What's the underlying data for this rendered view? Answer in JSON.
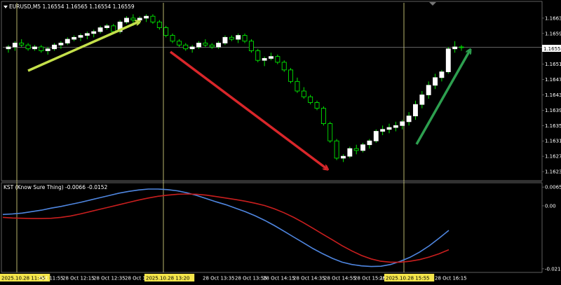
{
  "header": {
    "symbol_line": "EURUSD,M5  1.16554 1.16565 1.16554 1.16559",
    "indicator_line": "KST (Know Sure Thing) -0.0066 -0.0152"
  },
  "price_axis": {
    "labels": [
      "1.16635",
      "1.16595",
      "1.16559",
      "1.16515",
      "1.16475",
      "1.16435",
      "1.16395",
      "1.16355",
      "1.16315",
      "1.16275",
      "1.16235"
    ],
    "current_price": "1.16559"
  },
  "kst_axis": {
    "labels": [
      "0.0065",
      "0.00",
      "-0.0218"
    ]
  },
  "time_axis": {
    "labels": [
      "2025.10.28 11:45",
      "Oct 11:55",
      "28 Oct 12:15",
      "28 Oct 12:35",
      "28 Oct 12",
      "2025.10.28 13:20",
      "28 Oct 13:35",
      "28 Oct 13:55",
      "28 Oct 14:15",
      "28 Oct 14:35",
      "28 Oct 14:55",
      "28 Oct 15:15",
      "28 Oct",
      "2025.10.28 15:55",
      "28 Oct 16:15"
    ],
    "highlighted": [
      "2025.10.28 11:45",
      "2025.10.28 13:20",
      "2025.10.28 15:55"
    ]
  },
  "colors": {
    "background": "#000000",
    "bull_candle": "#ffffff",
    "bear_outline": "#00ff00",
    "kst_blue": "#4f86e0",
    "kst_red": "#c81e1e",
    "arrow_yellow": "#c4e04a",
    "arrow_red": "#d9262a",
    "arrow_green": "#2d9f4f",
    "vline": "#e8e48a",
    "label_bg": "#f5e64b"
  },
  "chart_data": [
    {
      "type": "candlestick",
      "title": "EURUSD,M5",
      "series_name": "EURUSD",
      "ylim": [
        1.16215,
        1.16675
      ],
      "candles": [
        [
          1.16555,
          1.16565,
          1.16545,
          1.1656
        ],
        [
          1.1656,
          1.16575,
          1.1655,
          1.1657
        ],
        [
          1.1657,
          1.1658,
          1.1656,
          1.16565
        ],
        [
          1.16565,
          1.1657,
          1.1655,
          1.16555
        ],
        [
          1.16555,
          1.16565,
          1.1655,
          1.1656
        ],
        [
          1.1656,
          1.16565,
          1.16545,
          1.1655
        ],
        [
          1.1655,
          1.1656,
          1.1654,
          1.16555
        ],
        [
          1.16555,
          1.1657,
          1.1655,
          1.16565
        ],
        [
          1.16565,
          1.16575,
          1.16555,
          1.1657
        ],
        [
          1.1657,
          1.16585,
          1.16565,
          1.1658
        ],
        [
          1.1658,
          1.1659,
          1.16575,
          1.16585
        ],
        [
          1.16585,
          1.16595,
          1.16575,
          1.1659
        ],
        [
          1.1659,
          1.166,
          1.1658,
          1.16595
        ],
        [
          1.16595,
          1.16605,
          1.16585,
          1.166
        ],
        [
          1.166,
          1.16615,
          1.16595,
          1.1661
        ],
        [
          1.1661,
          1.1662,
          1.16605,
          1.16615
        ],
        [
          1.16615,
          1.1662,
          1.16595,
          1.166
        ],
        [
          1.166,
          1.1663,
          1.16595,
          1.16625
        ],
        [
          1.16625,
          1.1664,
          1.1662,
          1.16635
        ],
        [
          1.16635,
          1.16645,
          1.16615,
          1.1663
        ],
        [
          1.1663,
          1.1664,
          1.1662,
          1.16635
        ],
        [
          1.16635,
          1.16645,
          1.16625,
          1.1664
        ],
        [
          1.1664,
          1.16645,
          1.1662,
          1.16625
        ],
        [
          1.16625,
          1.1663,
          1.16605,
          1.1661
        ],
        [
          1.1661,
          1.16615,
          1.16585,
          1.1659
        ],
        [
          1.1659,
          1.16595,
          1.1657,
          1.16575
        ],
        [
          1.16575,
          1.1658,
          1.1656,
          1.16565
        ],
        [
          1.16565,
          1.1657,
          1.1655,
          1.16555
        ],
        [
          1.16555,
          1.16565,
          1.16545,
          1.1656
        ],
        [
          1.1656,
          1.16575,
          1.16555,
          1.1657
        ],
        [
          1.1657,
          1.1658,
          1.1656,
          1.16565
        ],
        [
          1.16565,
          1.1657,
          1.16555,
          1.1656
        ],
        [
          1.1656,
          1.16575,
          1.16555,
          1.1657
        ],
        [
          1.1657,
          1.1659,
          1.16565,
          1.16585
        ],
        [
          1.16585,
          1.1659,
          1.16575,
          1.1658
        ],
        [
          1.1658,
          1.16595,
          1.1657,
          1.1659
        ],
        [
          1.1659,
          1.16595,
          1.1657,
          1.16575
        ],
        [
          1.16575,
          1.1658,
          1.16545,
          1.1655
        ],
        [
          1.1655,
          1.16555,
          1.1652,
          1.16525
        ],
        [
          1.16525,
          1.16535,
          1.1651,
          1.1653
        ],
        [
          1.1653,
          1.16545,
          1.16525,
          1.16535
        ],
        [
          1.16535,
          1.1654,
          1.16515,
          1.1652
        ],
        [
          1.1652,
          1.16525,
          1.16495,
          1.165
        ],
        [
          1.165,
          1.16505,
          1.16465,
          1.1647
        ],
        [
          1.1647,
          1.1648,
          1.1644,
          1.16445
        ],
        [
          1.16445,
          1.16455,
          1.16425,
          1.1643
        ],
        [
          1.1643,
          1.16435,
          1.1641,
          1.16415
        ],
        [
          1.16415,
          1.1642,
          1.16395,
          1.164
        ],
        [
          1.164,
          1.16405,
          1.16355,
          1.1636
        ],
        [
          1.1636,
          1.16365,
          1.1631,
          1.16315
        ],
        [
          1.16315,
          1.1632,
          1.16265,
          1.1627
        ],
        [
          1.1627,
          1.1628,
          1.1626,
          1.16275
        ],
        [
          1.16275,
          1.163,
          1.1627,
          1.16295
        ],
        [
          1.16295,
          1.16305,
          1.1628,
          1.1629
        ],
        [
          1.1629,
          1.1631,
          1.16285,
          1.16305
        ],
        [
          1.16305,
          1.1632,
          1.16295,
          1.16315
        ],
        [
          1.16315,
          1.16345,
          1.1631,
          1.1634
        ],
        [
          1.1634,
          1.16355,
          1.1633,
          1.16345
        ],
        [
          1.16345,
          1.1636,
          1.16335,
          1.1635
        ],
        [
          1.1635,
          1.16365,
          1.1634,
          1.16355
        ],
        [
          1.16355,
          1.1637,
          1.16345,
          1.16365
        ],
        [
          1.16365,
          1.1639,
          1.16355,
          1.1638
        ],
        [
          1.1638,
          1.1642,
          1.1637,
          1.1641
        ],
        [
          1.1641,
          1.16445,
          1.164,
          1.16435
        ],
        [
          1.16435,
          1.1647,
          1.16425,
          1.1646
        ],
        [
          1.1646,
          1.1649,
          1.1645,
          1.1648
        ],
        [
          1.1648,
          1.165,
          1.1647,
          1.16495
        ],
        [
          1.16495,
          1.1656,
          1.1649,
          1.16555
        ],
        [
          1.16555,
          1.16575,
          1.16545,
          1.1656
        ],
        [
          1.1656,
          1.16565,
          1.1655,
          1.16559
        ]
      ]
    },
    {
      "type": "line",
      "title": "KST (Know Sure Thing)",
      "ylim": [
        -0.0228,
        0.0075
      ],
      "series": [
        {
          "name": "KST",
          "values": [
            -0.003,
            -0.0028,
            -0.0025,
            -0.002,
            -0.0015,
            -0.0008,
            -0.0002,
            0.0005,
            0.0012,
            0.002,
            0.0028,
            0.0036,
            0.0044,
            0.005,
            0.0055,
            0.0058,
            0.0058,
            0.0056,
            0.0052,
            0.0045,
            0.0036,
            0.0025,
            0.0014,
            0.0004,
            -0.0008,
            -0.002,
            -0.0034,
            -0.005,
            -0.0068,
            -0.0088,
            -0.0108,
            -0.0128,
            -0.0148,
            -0.0166,
            -0.0182,
            -0.0195,
            -0.0203,
            -0.0208,
            -0.021,
            -0.0209,
            -0.0203,
            -0.0192,
            -0.0178,
            -0.016,
            -0.0138,
            -0.0112,
            -0.0085
          ]
        },
        {
          "name": "Signal",
          "values": [
            -0.004,
            -0.0042,
            -0.0043,
            -0.0044,
            -0.0044,
            -0.0043,
            -0.004,
            -0.0035,
            -0.0028,
            -0.002,
            -0.0012,
            -0.0004,
            0.0004,
            0.0012,
            0.002,
            0.0027,
            0.0033,
            0.0037,
            0.004,
            0.0041,
            0.004,
            0.0037,
            0.0032,
            0.0027,
            0.0022,
            0.0016,
            0.0009,
            0.0001,
            -0.001,
            -0.0024,
            -0.004,
            -0.0058,
            -0.0078,
            -0.0098,
            -0.0118,
            -0.0138,
            -0.0156,
            -0.0172,
            -0.0184,
            -0.0192,
            -0.0195,
            -0.0195,
            -0.0192,
            -0.0186,
            -0.0177,
            -0.0166,
            -0.0152
          ]
        }
      ]
    }
  ]
}
